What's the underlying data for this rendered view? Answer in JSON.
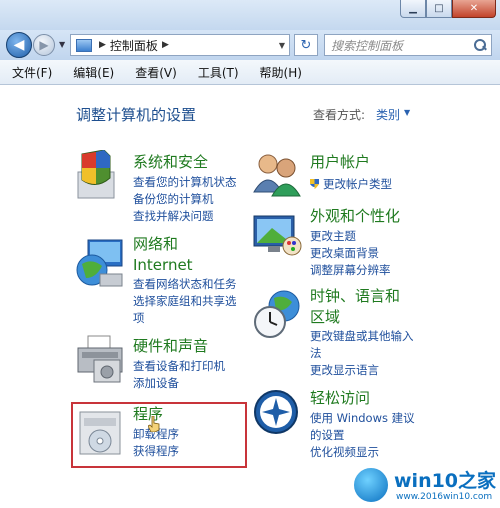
{
  "address": {
    "crumb": "控制面板"
  },
  "search": {
    "placeholder": "搜索控制面板"
  },
  "menu": [
    "文件(F)",
    "编辑(E)",
    "查看(V)",
    "工具(T)",
    "帮助(H)"
  ],
  "content": {
    "title": "调整计算机的设置",
    "view_by_label": "查看方式:",
    "view_by_value": "类别"
  },
  "categories": {
    "system_security": {
      "title": "系统和安全",
      "links": [
        "查看您的计算机状态",
        "备份您的计算机",
        "查找并解决问题"
      ]
    },
    "network": {
      "title_line1": "网络和",
      "title_line2": "Internet",
      "links": [
        "查看网络状态和任务",
        "选择家庭组和共享选",
        "项"
      ]
    },
    "hardware": {
      "title": "硬件和声音",
      "links": [
        "查看设备和打印机",
        "添加设备"
      ]
    },
    "programs": {
      "title": "程序",
      "links": [
        "卸载程序",
        "获得程序"
      ]
    },
    "user_accounts": {
      "title": "用户帐户",
      "links": [
        "更改帐户类型"
      ]
    },
    "appearance": {
      "title": "外观和个性化",
      "links": [
        "更改主题",
        "更改桌面背景",
        "调整屏幕分辨率"
      ]
    },
    "clock": {
      "title_line1": "时钟、语言和",
      "title_line2": "区域",
      "links": [
        "更改键盘或其他输入",
        "法",
        "更改显示语言"
      ]
    },
    "ease": {
      "title": "轻松访问",
      "links": [
        "使用 Windows 建议",
        "的设置",
        "优化视频显示"
      ]
    }
  },
  "logo": {
    "text": "win10之家",
    "url": "www.2016win10.com"
  }
}
